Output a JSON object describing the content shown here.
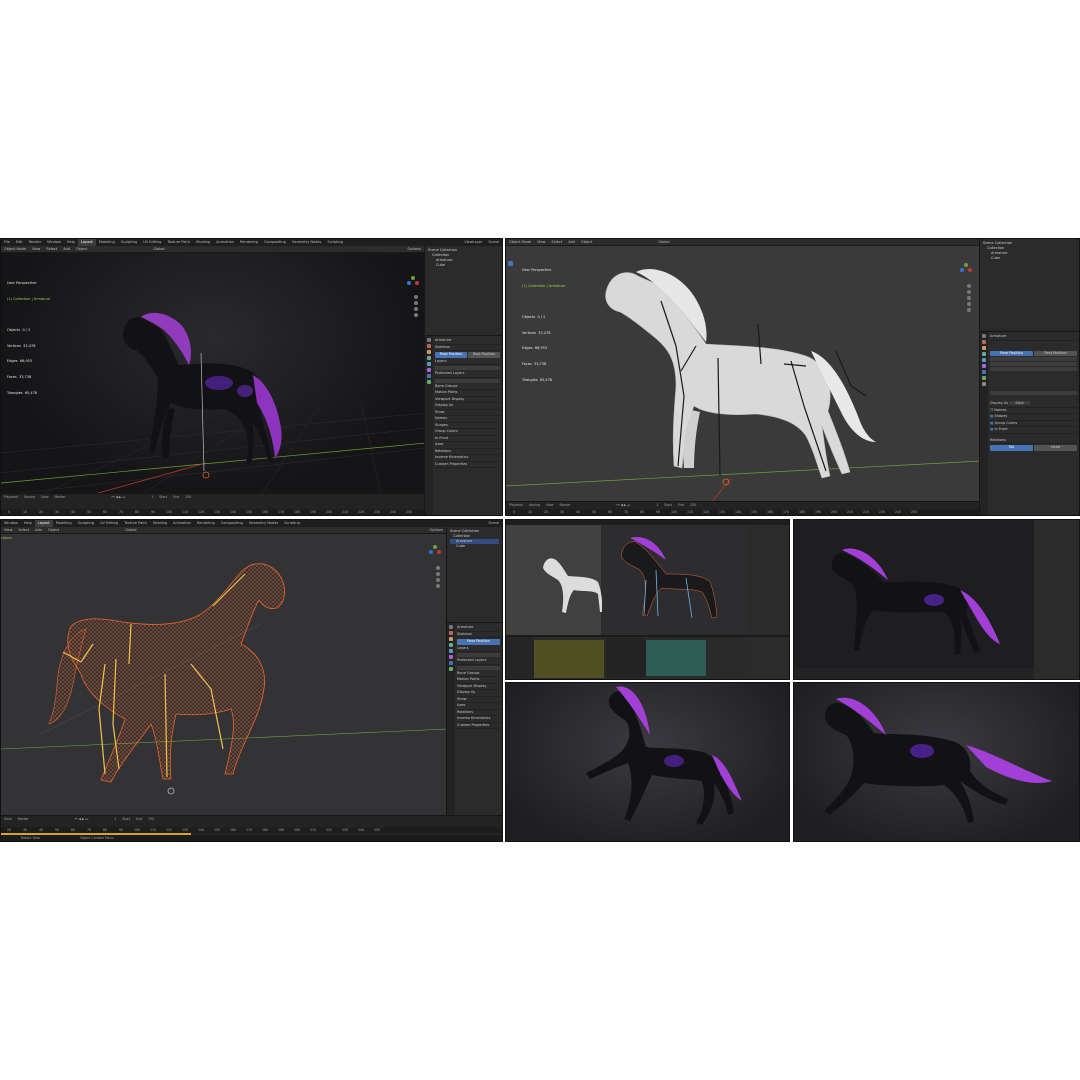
{
  "panel_a": {
    "menu": [
      "File",
      "Edit",
      "Render",
      "Window",
      "Help"
    ],
    "workspaces": [
      "Layout",
      "Modeling",
      "Sculpting",
      "UV Editing",
      "Texture Paint",
      "Shading",
      "Animation",
      "Rendering",
      "Compositing",
      "Geometry Nodes",
      "Scripting"
    ],
    "active_workspace": "Layout",
    "scene_label": "Scene",
    "viewlayer_label": "ViewLayer",
    "header": [
      "Object Mode",
      "View",
      "Select",
      "Add",
      "Object"
    ],
    "transform": "Global",
    "options": "Options",
    "stats_title": "User Perspective",
    "stats_collection": "(1) Collection | Armature",
    "stats_lines": [
      "Objects  0 / 2",
      "Vertices  33,478",
      "Edges  66,953",
      "Faces  33,738",
      "Triangles  65,478"
    ],
    "outliner": [
      "Scene Collection",
      "Collection",
      "Armature",
      "Cube"
    ],
    "props_title": "Armature",
    "props_sections": [
      "Skeleton",
      "Pose Position",
      "Rest Position",
      "Layers",
      "Protected Layers",
      "Bone Groups",
      "Motion Paths",
      "Viewport Display",
      "Display As",
      "Show",
      "Names",
      "Shapes",
      "Group Colors",
      "In Front",
      "Axes",
      "Relations",
      "Inverse Kinematics",
      "Custom Properties"
    ],
    "timeline": [
      "Playback",
      "Keying",
      "View",
      "Marker"
    ],
    "start_label": "Start",
    "end_label": "End",
    "start_value": "1",
    "end_value": "250",
    "frames": [
      "0",
      "10",
      "20",
      "30",
      "40",
      "50",
      "60",
      "70",
      "80",
      "90",
      "100",
      "110",
      "120",
      "130",
      "140",
      "150",
      "160",
      "170",
      "180",
      "190",
      "200",
      "210",
      "220",
      "230",
      "240",
      "250"
    ]
  },
  "panel_b": {
    "header": [
      "Object Mode",
      "View",
      "Select",
      "Add",
      "Object"
    ],
    "transform": "Global",
    "stats_title": "User Perspective",
    "stats_collection": "(1) Collection | Armature",
    "stats_lines": [
      "Objects  0 / 2",
      "Vertices  33,478",
      "Edges  66,953",
      "Faces  33,738",
      "Triangles  65,478"
    ],
    "outliner": [
      "Scene Collection",
      "Collection",
      "Armature",
      "Cube"
    ],
    "props_title": "Armature",
    "pose_position": "Pose Position",
    "rest_position": "Rest Position",
    "display_as": "Display As",
    "display_value": "Stick",
    "show_items": [
      "Names",
      "Shapes",
      "Group Colors",
      "In Front"
    ],
    "relations": "Relations",
    "tail": "Tail",
    "head": "Head",
    "timeline": [
      "Playback",
      "Keying",
      "View",
      "Marker"
    ],
    "start_label": "Start",
    "end_label": "End",
    "start_value": "1",
    "end_value": "250",
    "frames": [
      "0",
      "10",
      "20",
      "30",
      "40",
      "50",
      "60",
      "70",
      "80",
      "90",
      "100",
      "110",
      "120",
      "130",
      "140",
      "150",
      "160",
      "170",
      "180",
      "190",
      "200",
      "210",
      "220",
      "230",
      "240",
      "250"
    ]
  },
  "panel_c": {
    "menu": [
      "Window",
      "Help"
    ],
    "workspaces": [
      "Layout",
      "Modeling",
      "Sculpting",
      "UV Editing",
      "Texture Paint",
      "Shading",
      "Animation",
      "Rendering",
      "Compositing",
      "Geometry Nodes",
      "Scripting"
    ],
    "active_workspace": "Layout",
    "scene_label": "Scene",
    "header": [
      "View",
      "Select",
      "Add",
      "Object"
    ],
    "transform": "Global",
    "options": "Options",
    "mode_label": "rature",
    "outliner": [
      "Scene Collection",
      "Collection",
      "Armature",
      "Cube"
    ],
    "props_title": "Armature",
    "props_sections": [
      "Skeleton",
      "Pose Position",
      "Layers",
      "Protected Layers",
      "Bone Groups",
      "Motion Paths",
      "Viewport Display",
      "Display As",
      "Show",
      "Axes",
      "Relations",
      "Inverse Kinematics",
      "Custom Properties"
    ],
    "timeline": [
      "View",
      "Marker"
    ],
    "start_label": "Start",
    "end_label": "End",
    "start_value": "1",
    "end_value": "250",
    "frames": [
      "20",
      "30",
      "40",
      "50",
      "60",
      "70",
      "80",
      "90",
      "100",
      "110",
      "120",
      "130",
      "140",
      "150",
      "160",
      "170",
      "180",
      "190",
      "200",
      "210",
      "220",
      "230",
      "240",
      "250"
    ],
    "status": [
      "Rotate View",
      "Object Context Menu"
    ]
  },
  "colors": {
    "accent_blue": "#4772b3",
    "wireframe_orange": "#e8642a",
    "bone_yellow": "#f2c14a",
    "mane_purple": "#a23fd6",
    "x_axis_red": "#c0392b",
    "y_axis_green": "#6ca23a"
  }
}
